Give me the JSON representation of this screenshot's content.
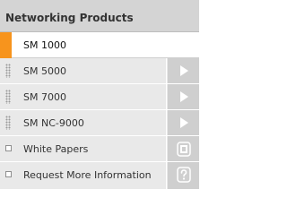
{
  "header": {
    "title": "Networking Products"
  },
  "active_item": {
    "label": "SM 1000",
    "marker_color": "#f7941d"
  },
  "sub_items": [
    {
      "label": "SM 5000",
      "icon": "arrow-right-icon"
    },
    {
      "label": "SM 7000",
      "icon": "arrow-right-icon"
    },
    {
      "label": "SM NC-9000",
      "icon": "arrow-right-icon"
    }
  ],
  "links": [
    {
      "label": "White Papers",
      "icon": "document-icon"
    },
    {
      "label": "Request More Information",
      "icon": "help-icon"
    }
  ]
}
